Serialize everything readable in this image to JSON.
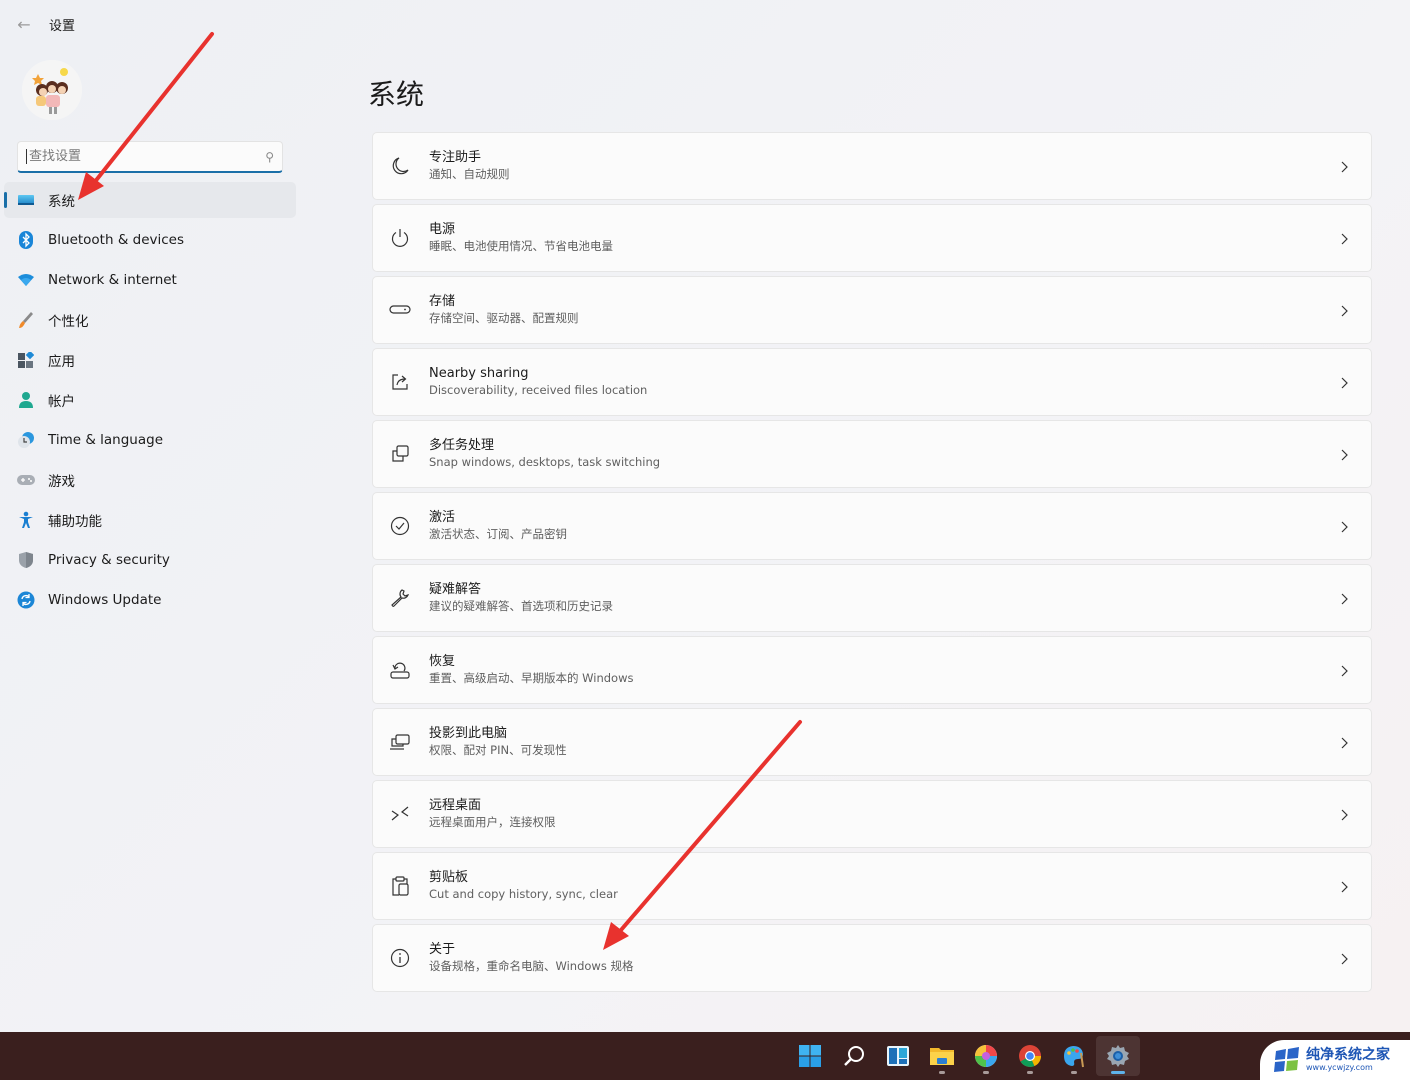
{
  "window": {
    "title": "设置",
    "back_icon": "arrow-left-icon"
  },
  "sidebar": {
    "avatar": "user-avatar",
    "search": {
      "placeholder": "查找设置",
      "value": "",
      "icon": "search-icon"
    },
    "items": [
      {
        "label": "系统",
        "icon": "system-display-icon",
        "active": true
      },
      {
        "label": "Bluetooth & devices",
        "icon": "bluetooth-icon",
        "active": false
      },
      {
        "label": "Network & internet",
        "icon": "wifi-icon",
        "active": false
      },
      {
        "label": "个性化",
        "icon": "brush-icon",
        "active": false
      },
      {
        "label": "应用",
        "icon": "apps-icon",
        "active": false
      },
      {
        "label": "帐户",
        "icon": "account-icon",
        "active": false
      },
      {
        "label": "Time & language",
        "icon": "clock-globe-icon",
        "active": false
      },
      {
        "label": "游戏",
        "icon": "gamepad-icon",
        "active": false
      },
      {
        "label": "辅助功能",
        "icon": "accessibility-icon",
        "active": false
      },
      {
        "label": "Privacy & security",
        "icon": "shield-icon",
        "active": false
      },
      {
        "label": "Windows Update",
        "icon": "update-icon",
        "active": false
      }
    ]
  },
  "main": {
    "title": "系统",
    "cards": [
      {
        "title": "专注助手",
        "desc": "通知、自动规则",
        "icon": "moon-icon"
      },
      {
        "title": "电源",
        "desc": "睡眠、电池使用情况、节省电池电量",
        "icon": "power-icon"
      },
      {
        "title": "存储",
        "desc": "存储空间、驱动器、配置规则",
        "icon": "storage-drive-icon"
      },
      {
        "title": "Nearby sharing",
        "desc": "Discoverability, received files location",
        "icon": "share-icon"
      },
      {
        "title": "多任务处理",
        "desc": "Snap windows, desktops, task switching",
        "icon": "multitask-icon"
      },
      {
        "title": "激活",
        "desc": "激活状态、订阅、产品密钥",
        "icon": "check-circle-icon"
      },
      {
        "title": "疑难解答",
        "desc": "建议的疑难解答、首选项和历史记录",
        "icon": "wrench-icon"
      },
      {
        "title": "恢复",
        "desc": "重置、高级启动、早期版本的 Windows",
        "icon": "recovery-icon"
      },
      {
        "title": "投影到此电脑",
        "desc": "权限、配对 PIN、可发现性",
        "icon": "project-icon"
      },
      {
        "title": "远程桌面",
        "desc": "远程桌面用户，连接权限",
        "icon": "remote-desktop-icon"
      },
      {
        "title": "剪贴板",
        "desc": "Cut and copy history, sync, clear",
        "icon": "clipboard-icon"
      },
      {
        "title": "关于",
        "desc": "设备规格，重命名电脑、Windows 规格",
        "icon": "info-icon"
      }
    ],
    "chevron_icon": "chevron-right-icon"
  },
  "taskbar": {
    "items": [
      {
        "name": "start-button",
        "icon": "windows-logo-icon"
      },
      {
        "name": "search-button",
        "icon": "search-icon"
      },
      {
        "name": "widgets-button",
        "icon": "widgets-icon"
      },
      {
        "name": "file-explorer-button",
        "icon": "folder-icon"
      },
      {
        "name": "photos-app-button",
        "icon": "pinwheel-icon"
      },
      {
        "name": "chrome-button",
        "icon": "chrome-icon"
      },
      {
        "name": "paint-button",
        "icon": "palette-icon"
      },
      {
        "name": "settings-button",
        "icon": "gear-icon"
      }
    ]
  },
  "watermark": {
    "title": "纯净系统之家",
    "url": "www.ycwjzy.com"
  },
  "colors": {
    "accent": "#1a6fa8",
    "annotation_arrow": "#e8322e",
    "taskbar_bg": "#3a1f1e"
  }
}
